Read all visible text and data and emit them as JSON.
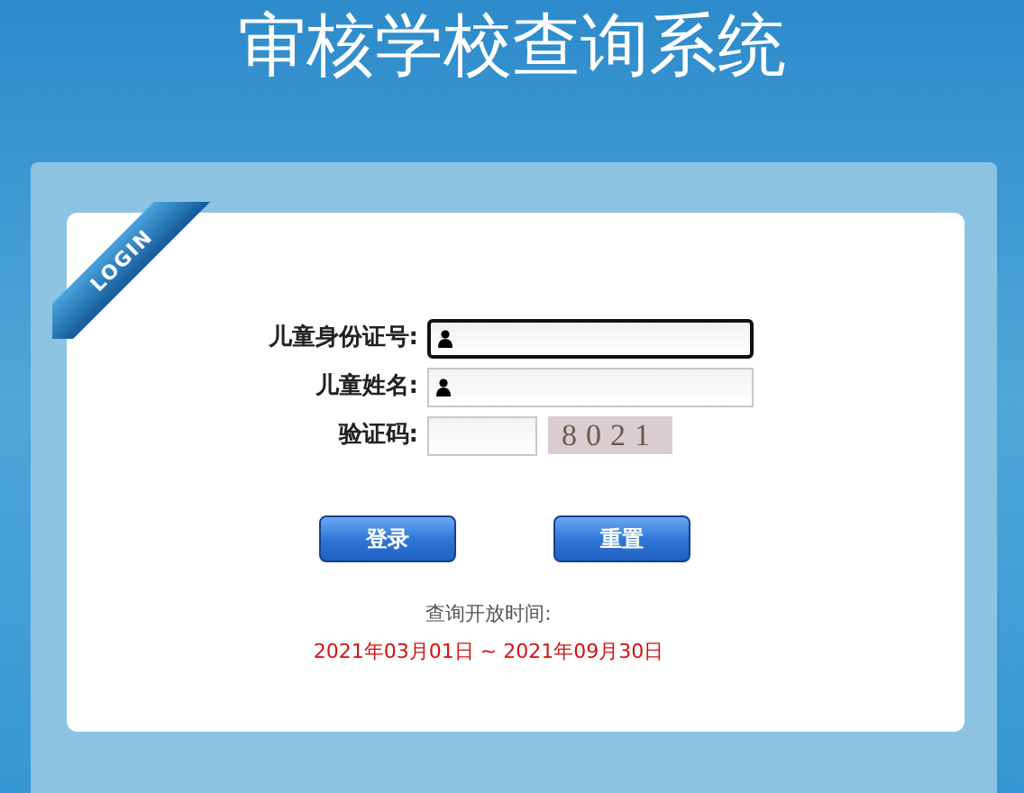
{
  "title": "审核学校查询系统",
  "ribbon": "LOGIN",
  "fields": [
    {
      "label": "儿童身份证号:",
      "kind": "user",
      "focused": true
    },
    {
      "label": "儿童姓名:",
      "kind": "user",
      "focused": false
    },
    {
      "label": "验证码:",
      "kind": "captcha",
      "focused": false,
      "captcha": "8021"
    }
  ],
  "buttons": [
    "登录",
    "重置"
  ],
  "notice": {
    "label": "查询开放时间:",
    "period": "2021年03月01日 ~ 2021年09月30日"
  }
}
